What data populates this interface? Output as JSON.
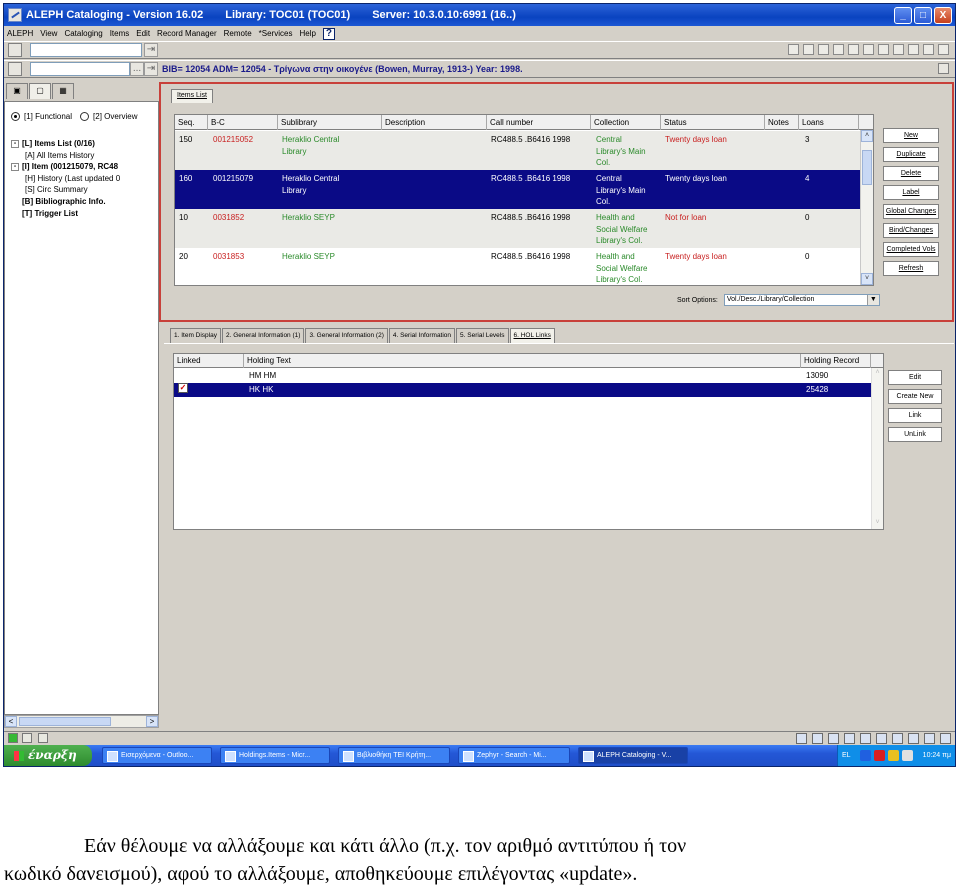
{
  "window": {
    "title_app": "ALEPH Cataloging - Version 16.02",
    "title_library": "Library:  TOC01 (TOC01)",
    "title_server": "Server:  10.3.0.10:6991 (16..)",
    "controls": [
      "_",
      "□",
      "X"
    ]
  },
  "menubar": [
    "ALEPH",
    "View",
    "Cataloging",
    "Items",
    "Edit",
    "Record Manager",
    "Remote",
    "*Services",
    "Help"
  ],
  "toolbar": {
    "bib_line": "BIB= 12054 ADM= 12054 - Τρίγωνα στην οικογένε (Bowen, Murray, 1913-) Year: 1998.",
    "dots": "...",
    "arrow": "⇥"
  },
  "left_panel": {
    "tabs": [
      "▣",
      "▢",
      "▦"
    ],
    "radio_functional": "[1] Functional",
    "radio_overview": "[2] Overview",
    "tree": [
      {
        "label": "[L] Items List (0/16)",
        "bold": true,
        "expander": "-",
        "level": 0
      },
      {
        "label": "[A] All Items History",
        "bold": false,
        "expander": "",
        "level": 1
      },
      {
        "label": "[I] Item (001215079, RC48",
        "bold": true,
        "expander": "-",
        "level": 0
      },
      {
        "label": "[H] History (Last updated 0",
        "bold": false,
        "expander": "",
        "level": 1
      },
      {
        "label": "[S] Circ Summary",
        "bold": false,
        "expander": "",
        "level": 1
      },
      {
        "label": "[B] Bibliographic Info.",
        "bold": true,
        "expander": "",
        "level": 0
      },
      {
        "label": "[T] Trigger List",
        "bold": true,
        "expander": "",
        "level": 0
      }
    ],
    "scroll_left": "<",
    "scroll_right": ">"
  },
  "items": {
    "tab_label": "Items List",
    "columns": [
      "Seq.",
      "B-C",
      "Sublibrary",
      "Description",
      "Call number",
      "Collection",
      "Status",
      "Notes",
      "Loans"
    ],
    "rows": [
      {
        "seq": "150",
        "bc": "001215052",
        "sub_1": "Heraklio Central",
        "sub_2": "Library",
        "desc": "",
        "call": "RC488.5 .B6416 1998",
        "col_1": "Central",
        "col_2": "Library's Main",
        "col_3": "Col.",
        "status": "Twenty days loan",
        "status_color": "red",
        "notes": "",
        "loans": "3",
        "selected": false
      },
      {
        "seq": "160",
        "bc": "001215079",
        "sub_1": "Heraklio Central",
        "sub_2": "Library",
        "desc": "",
        "call": "RC488.5 .B6416 1998",
        "col_1": "Central",
        "col_2": "Library's Main",
        "col_3": "Col.",
        "status": "Twenty days loan",
        "status_color": "red",
        "notes": "",
        "loans": "4",
        "selected": true
      },
      {
        "seq": "10",
        "bc": "0031852",
        "sub_1": "Heraklio SEYP",
        "sub_2": "",
        "desc": "",
        "call": "RC488.5 .B6416 1998",
        "col_1": "Health and",
        "col_2": "Social Welfare",
        "col_3": "Library's Col.",
        "status": "Not for loan",
        "status_color": "red",
        "notes": "",
        "loans": "0",
        "selected": false
      },
      {
        "seq": "20",
        "bc": "0031853",
        "sub_1": "Heraklio SEYP",
        "sub_2": "",
        "desc": "",
        "call": "RC488.5 .B6416 1998",
        "col_1": "Health and",
        "col_2": "Social Welfare",
        "col_3": "Library's Col.",
        "status": "Twenty days loan",
        "status_color": "red",
        "notes": "",
        "loans": "0",
        "selected": false
      }
    ],
    "buttons": [
      "New",
      "Duplicate",
      "Delete",
      "Label",
      "Global Changes",
      "Bind/Changes",
      "Completed Vols",
      "Refresh"
    ],
    "sort_label": "Sort Options:",
    "sort_value": "Vol./Desc./Library/Collection",
    "sort_arrow": "▼",
    "scroll_up": "˄",
    "scroll_down": "˅"
  },
  "lower_tabs": [
    "1. Item Display",
    "2. General Information (1)",
    "3. General Information (2)",
    "4. Serial Information",
    "5. Serial Levels",
    "6. HOL Links"
  ],
  "hol": {
    "columns": [
      "Linked",
      "Holding Text",
      "Holding Record"
    ],
    "rows": [
      {
        "linked": "",
        "text": "HM HM",
        "record": "13090",
        "selected": false
      },
      {
        "linked": "✓",
        "text": "HK HK",
        "record": "25428",
        "selected": true
      }
    ],
    "buttons": [
      "Edit",
      "Create New",
      "Link",
      "UnLink"
    ],
    "scroll_up": "˄",
    "scroll_down": "˅"
  },
  "taskbar": {
    "start": "έναρξη",
    "tasks": [
      "Εισερχόμενα - Outloo...",
      "Holdings.Items - Micr...",
      "Βιβλιοθήκη ΤΕΙ Κρήτη...",
      "Zephyr - Search - Mi...",
      "ALEPH Cataloging - V..."
    ],
    "lang": "EL",
    "clock": "10:24 πμ"
  },
  "caption": {
    "line1": "Εάν θέλουμε να αλλάξουμε και κάτι άλλο (π.χ. τον αριθμό αντιτύπου ή τον",
    "line2": "κωδικό δανεισμού), αφού το αλλάξουμε, αποθηκεύουμε επιλέγοντας «update»."
  },
  "colors": {
    "selection": "#0a0a86",
    "frame_highlight": "#c8403a",
    "sublibrary_text": "#2a8a2a",
    "status_text": "#c82020",
    "titlebar": "#0a43c0"
  }
}
